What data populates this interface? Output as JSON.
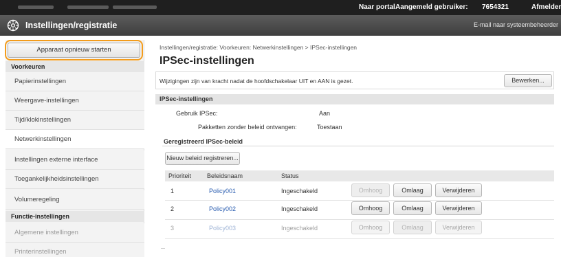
{
  "topbar": {
    "portal": "Naar portal",
    "logged_in_label": "Aangemeld gebruiker:",
    "user": "7654321",
    "logout": "Afmelden"
  },
  "titlebar": {
    "title": "Instellingen/registratie",
    "mail_link": "E-mail naar systeembeheerder"
  },
  "sidebar": {
    "restart_button": "Apparaat opnieuw starten",
    "section_preferences": "Voorkeuren",
    "items": [
      {
        "label": "Papierinstellingen"
      },
      {
        "label": "Weergave-instellingen"
      },
      {
        "label": "Tijd/klokinstellingen"
      },
      {
        "label": "Netwerkinstellingen"
      },
      {
        "label": "Instellingen externe interface"
      },
      {
        "label": "Toegankelijkheidsinstellingen"
      },
      {
        "label": "Volumeregeling"
      }
    ],
    "section_functions": "Functie-instellingen",
    "function_items": [
      {
        "label": "Algemene instellingen"
      },
      {
        "label": "Printerinstellingen"
      }
    ]
  },
  "main": {
    "breadcrumb": "Instellingen/registratie: Voorkeuren: Netwerkinstellingen > IPSec-instellingen",
    "title": "IPSec-instellingen",
    "note": "Wijzigingen zijn van kracht nadat de hoofdschakelaar UIT en AAN is gezet.",
    "edit_button": "Bewerken...",
    "section_title": "IPSec-instellingen",
    "use_ipsec_label": "Gebruik IPSec:",
    "use_ipsec_value": "Aan",
    "packets_label": "Pakketten zonder beleid ontvangen:",
    "packets_value": "Toestaan",
    "registered_title": "Geregistreerd IPSec-beleid",
    "register_button": "Nieuw beleid registreren...",
    "columns": {
      "priority": "Prioriteit",
      "policy_name": "Beleidsnaam",
      "status": "Status"
    },
    "rows": [
      {
        "priority": "1",
        "name": "Policy001",
        "status": "Ingeschakeld"
      },
      {
        "priority": "2",
        "name": "Policy002",
        "status": "Ingeschakeld"
      },
      {
        "priority": "3",
        "name": "Policy003",
        "status": "Ingeschakeld"
      }
    ],
    "btn_up": "Omhoog",
    "btn_down": "Omlaag",
    "btn_delete": "Verwijderen"
  },
  "colors": {
    "highlight": "#f39c1c",
    "link": "#2a5db0",
    "titlebar": "#4a4a4a"
  },
  "icons": {
    "app_icon": "settings-gear-icon"
  }
}
